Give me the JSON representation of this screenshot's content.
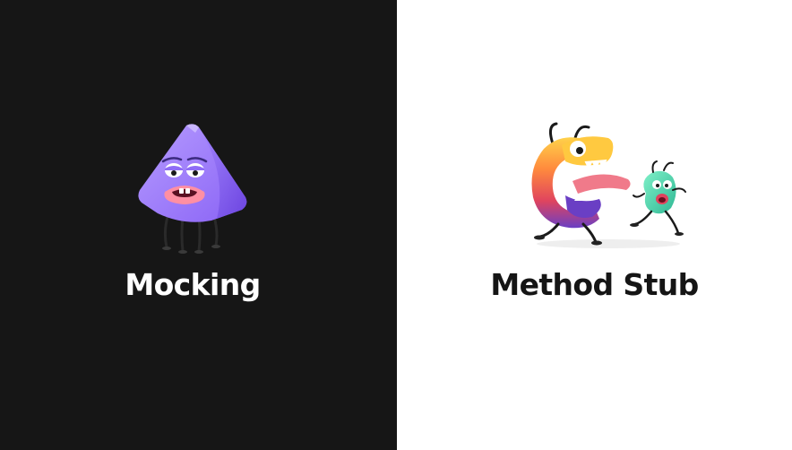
{
  "left_card": {
    "label": "Mocking",
    "background": "#161616",
    "text_color": "#ffffff",
    "illustration_icon": "sad-purple-pyramid-character-icon"
  },
  "right_card": {
    "label": "Method Stub",
    "background": "#ffffff",
    "text_color": "#151515",
    "illustration_icon": "chasing-monster-characters-icon"
  }
}
